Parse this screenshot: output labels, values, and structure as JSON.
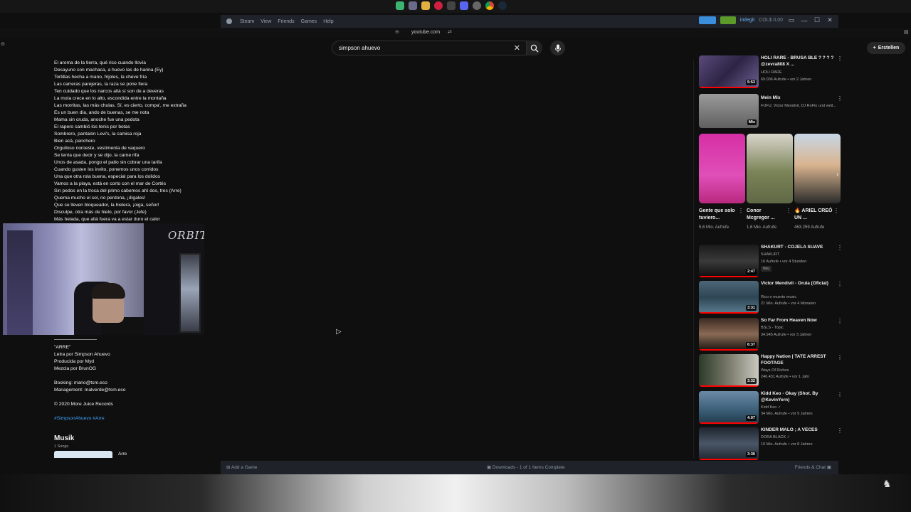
{
  "steam": {
    "menu": [
      "Steam",
      "View",
      "Friends",
      "Games",
      "Help"
    ],
    "user": "imlegit",
    "wallet": "COL$ 0,00",
    "add_game": "Add a Game",
    "downloads": "Downloads - 1 of 1 Items Complete",
    "friends_chat": "Friends & Chat"
  },
  "browser": {
    "url": "youtube.com"
  },
  "youtube": {
    "search_value": "simpson ahuevo",
    "create_label": "Erstellen"
  },
  "description": {
    "lyrics": [
      "El aroma de la tierra, qué rico cuando llovía",
      "Desayuno con machaca, a huevo las de harina (Ey)",
      "Tortillas hecha a mano, frijoles, la cheve fría",
      "Las carreras parejeras, la raza se pone fiera",
      "Ten cuidado que los narcos allá sí son de a deveras",
      "La mota crece en lo alto, escondida entre la montaña",
      "Las morritas, las más chulas. Sí, es cierto, compa', me extraña",
      "Es un buen día, ando de buenas, se me nota",
      "Mama sin cruda, anoche fue una pedota",
      "El rapero cambió los tenis por botas",
      "Sombrero, pantalón Levi's, la camisa roja",
      "Bien acá, panchero",
      "Orgulloso noroeste, vestimenta de vaquero",
      "Se tenía que decir y se dijo, la carne rifa",
      "Unos de asada, pongo el patio sin cobrar una tarifa",
      "Cuando gusten los invito, ponemos unos corridos",
      "Una que otra rola buena, especial para los dolidos",
      "Vamos a la playa, está en corto con el mar de Cortés",
      "Sin pedos en la troca del primo cabemos ahí dos, tres (Arre)",
      "Quema mucho el sol, no perdona, ¡dígales!",
      "Que se lleven bloqueador, la hielera, ¡oiga, señor!",
      "Disculpe, otra más de hielo, por favor (Jefe)",
      "Más helada, que allá fuera va a estar duro el calor"
    ],
    "credits": [
      "\"ARRE\"",
      "Letra por Simpson Ahuevo",
      "Producida por Myd",
      "Mezcla por BrunOG",
      "",
      "Booking: mario@tsm.eco",
      "Management: malverde@tsm.eco",
      "",
      "© 2020 More Juice Records",
      ""
    ],
    "hashtags": "#SimpsonAhuevo #Arre",
    "music_heading": "Musik",
    "songs_count": "1 Songs",
    "song_title": "Arre"
  },
  "webcam": {
    "logo": "ORBIT"
  },
  "sidebar": {
    "videos_top": [
      {
        "title": "HOLI RARE - BRUSA BLE ? ? ? ? @zevra808 X ...",
        "channel": "HOLI RARE",
        "meta": "69.006 Aufrufe • vor 2 Jahren",
        "duration": "5:53"
      },
      {
        "title": "Mein Mix",
        "channel": "FUFU, Victor Mendivil, DJ RoFlo und weit...",
        "meta": "",
        "duration": "Mix"
      }
    ],
    "shorts": [
      {
        "title": "Gente que solo tuviero...",
        "views": "5,6 Mio. Aufrufe"
      },
      {
        "title": "Conor Mcgregor ...",
        "views": "1,6 Mio. Aufrufe"
      },
      {
        "title": "🔥 ARIEL CREÓ UN ...",
        "views": "463.259 Aufrufe"
      }
    ],
    "videos": [
      {
        "title": "SHAKURT - COJELA SUAVE",
        "channel": "SHAKURT",
        "meta": "16 Aufrufe • vor 4 Stunden",
        "duration": "2:47",
        "badge": "Neu"
      },
      {
        "title": "Victor Mendivil - Orula (Oficial)",
        "channel": "Rico o muerto music",
        "meta": "21 Mio. Aufrufe • vor 4 Monaten",
        "duration": "3:31"
      },
      {
        "title": "So Far From Heaven Now",
        "channel": "BSLS - Topic",
        "meta": "34.945 Aufrufe • vor 3 Jahren",
        "duration": "6:37"
      },
      {
        "title": "Happy Nation | TATE ARREST FOOTAGE",
        "channel": "Ways Of Riches",
        "meta": "246.431 Aufrufe • vor 1 Jahr",
        "duration": "3:32"
      },
      {
        "title": "Kidd Keo - Okay (Shot. By @KevinYern)",
        "channel": "Kidd Keo ✓",
        "meta": "34 Mio. Aufrufe • vor 9 Jahren",
        "duration": "4:07"
      },
      {
        "title": "KINDER MALO ; A VECES",
        "channel": "DORA BLACK ✓",
        "meta": "10 Mio. Aufrufe • vor 8 Jahren",
        "duration": "3:30"
      }
    ]
  }
}
